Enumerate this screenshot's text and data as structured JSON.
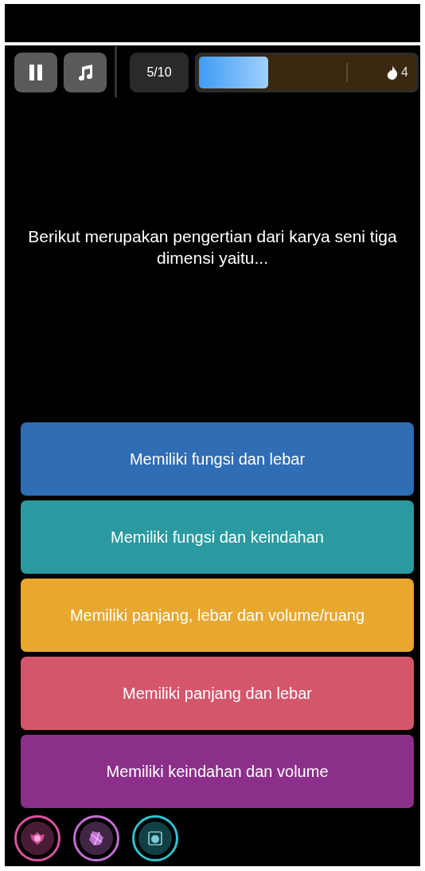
{
  "top_bar": {
    "counter": "5/10",
    "progress": {
      "level": 0.33
    },
    "streak": "4"
  },
  "question": "Berikut merupakan pengertian dari karya seni tiga dimensi yaitu...",
  "options": [
    {
      "label": "Memiliki fungsi dan lebar",
      "color": "#2f6db5"
    },
    {
      "label": "Memiliki fungsi dan keindahan",
      "color": "#2a9aa0"
    },
    {
      "label": "Memiliki panjang, lebar dan volume/ruang",
      "color": "#e8a72e"
    },
    {
      "label": "Memiliki panjang dan lebar",
      "color": "#d4566b"
    },
    {
      "label": "Memiliki keindahan dan volume",
      "color": "#8b2f8a"
    }
  ],
  "powerups": [
    {
      "color": "#d9539f"
    },
    {
      "color": "#c070d0"
    },
    {
      "color": "#30c0d0"
    }
  ]
}
